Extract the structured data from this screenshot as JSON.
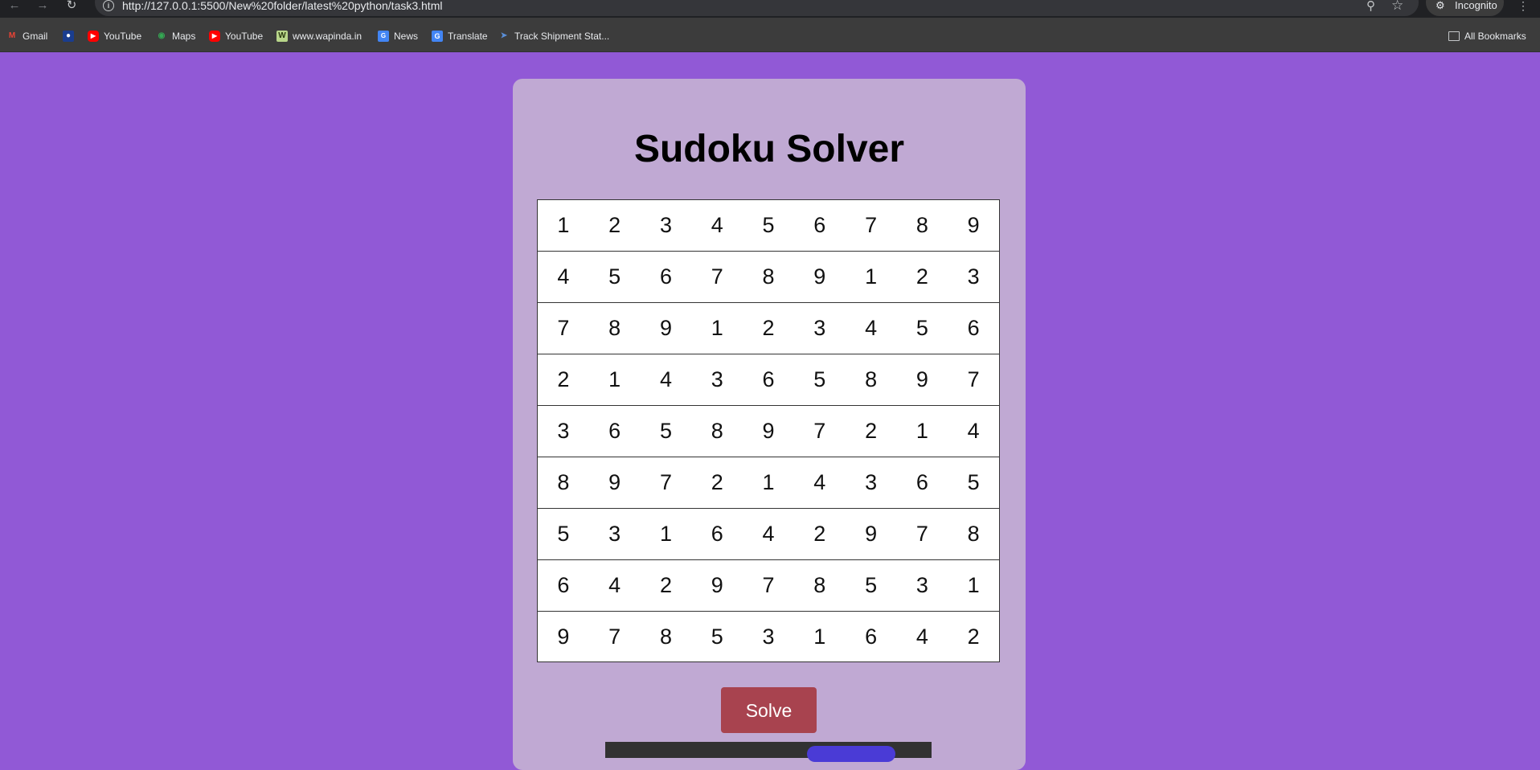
{
  "browser": {
    "url": "http://127.0.0.1:5500/New%20folder/latest%20python/task3.html",
    "profile_label": "Incognito",
    "all_bookmarks_label": "All Bookmarks",
    "bookmarks": [
      {
        "label": "Gmail",
        "icon": "gmail-icon",
        "color": "#ea4335"
      },
      {
        "label": "",
        "icon": "generic-site-icon",
        "color": "#1a3d8f"
      },
      {
        "label": "YouTube",
        "icon": "youtube-icon",
        "color": "#ff0000"
      },
      {
        "label": "Maps",
        "icon": "maps-icon",
        "color": "#34a853"
      },
      {
        "label": "YouTube",
        "icon": "youtube-icon",
        "color": "#ff0000"
      },
      {
        "label": "www.wapinda.in",
        "icon": "wapinda-icon",
        "color": "#b8d68a"
      },
      {
        "label": "News",
        "icon": "news-icon",
        "color": "#4285f4"
      },
      {
        "label": "Translate",
        "icon": "translate-icon",
        "color": "#4285f4"
      },
      {
        "label": "Track Shipment Stat...",
        "icon": "shipment-icon",
        "color": "#5a8fd8"
      }
    ]
  },
  "page": {
    "title": "Sudoku Solver",
    "solve_label": "Solve",
    "colors": {
      "background": "#9159d6",
      "card": "#c0a9d3",
      "button": "#a8434f"
    },
    "grid": [
      [
        "1",
        "2",
        "3",
        "4",
        "5",
        "6",
        "7",
        "8",
        "9"
      ],
      [
        "4",
        "5",
        "6",
        "7",
        "8",
        "9",
        "1",
        "2",
        "3"
      ],
      [
        "7",
        "8",
        "9",
        "1",
        "2",
        "3",
        "4",
        "5",
        "6"
      ],
      [
        "2",
        "1",
        "4",
        "3",
        "6",
        "5",
        "8",
        "9",
        "7"
      ],
      [
        "3",
        "6",
        "5",
        "8",
        "9",
        "7",
        "2",
        "1",
        "4"
      ],
      [
        "8",
        "9",
        "7",
        "2",
        "1",
        "4",
        "3",
        "6",
        "5"
      ],
      [
        "5",
        "3",
        "1",
        "6",
        "4",
        "2",
        "9",
        "7",
        "8"
      ],
      [
        "6",
        "4",
        "2",
        "9",
        "7",
        "8",
        "5",
        "3",
        "1"
      ],
      [
        "9",
        "7",
        "8",
        "5",
        "3",
        "1",
        "6",
        "4",
        "2"
      ]
    ]
  }
}
